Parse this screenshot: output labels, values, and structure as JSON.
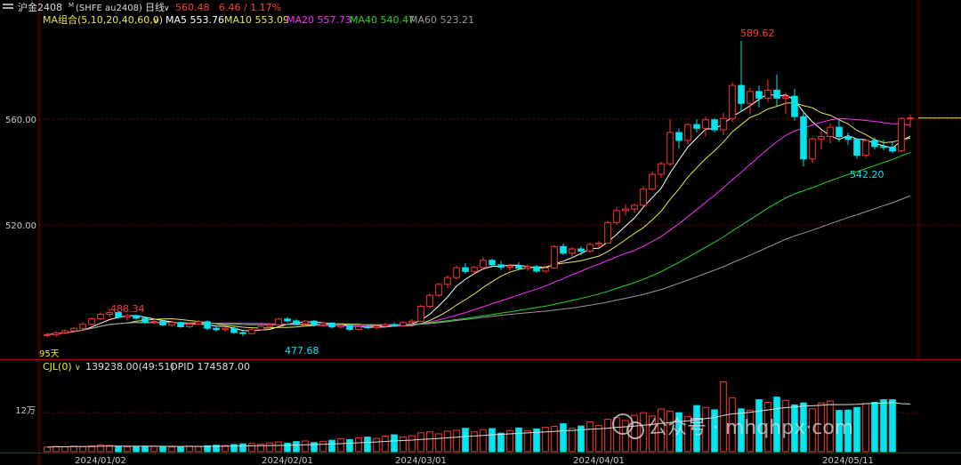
{
  "header": {
    "icon": "menu-lines-icon",
    "symbol": "沪金2408",
    "symbol_sup": "M",
    "code": "(SHFE au2408)",
    "period": "日线",
    "price": "560.48",
    "change": "6.46 / 1.17%"
  },
  "ma_legend": {
    "group": "MA组合(5,10,20,40,60,0)",
    "items": [
      {
        "label": "MA5 553.76",
        "color": "#ffffff"
      },
      {
        "label": "MA10 553.09",
        "color": "#e8e84a"
      },
      {
        "label": "MA20 557.73",
        "color": "#ff2cff"
      },
      {
        "label": "MA40 540.47",
        "color": "#22d822"
      },
      {
        "label": "MA60 523.21",
        "color": "#9a9a9a"
      }
    ]
  },
  "volume_legend": {
    "name": "CJL(0)",
    "vol": "139238.00(49:51)",
    "opid": "OPID 174587.00"
  },
  "price_axis": {
    "ticks": [
      {
        "value": 520,
        "label": "520.00"
      },
      {
        "value": 560,
        "label": "560.00"
      }
    ]
  },
  "volume_axis": {
    "tick_label": "12万",
    "tick_value": 120000
  },
  "annotations": {
    "high_label": "589.62",
    "low_label": "542.20",
    "left_high": "488.34",
    "left_low": "477.68",
    "corner": "95天"
  },
  "x_labels": [
    {
      "label": "2024/01/02",
      "index": 6
    },
    {
      "label": "2024/02/01",
      "index": 27
    },
    {
      "label": "2024/03/01",
      "index": 42
    },
    {
      "label": "2024/04/01",
      "index": 62
    },
    {
      "label": "2024/05/11",
      "index": 90
    }
  ],
  "watermark": "公众号 · mhqhpx·com",
  "colors": {
    "up": "#ff3232",
    "down": "#00e5ee",
    "grid": "#8b0000",
    "axis": "#8b0000"
  },
  "chart_data": {
    "type": "candlestick",
    "title": "沪金2408 日线",
    "ylim": [
      470,
      595
    ],
    "volume_ylim": [
      0,
      230000
    ],
    "candles": [
      [
        478.5,
        479.4,
        477.6,
        478.6
      ],
      [
        478.6,
        480.0,
        477.8,
        479.3
      ],
      [
        479.3,
        480.6,
        478.9,
        480.1
      ],
      [
        480.1,
        481.6,
        479.5,
        481.0
      ],
      [
        481.0,
        483.3,
        480.4,
        482.5
      ],
      [
        482.5,
        485.2,
        482.0,
        484.6
      ],
      [
        484.6,
        487.0,
        484.0,
        486.3
      ],
      [
        486.3,
        488.3,
        485.3,
        487.0
      ],
      [
        487.0,
        487.4,
        484.6,
        485.2
      ],
      [
        485.2,
        486.5,
        483.9,
        485.8
      ],
      [
        485.8,
        486.2,
        484.3,
        484.8
      ],
      [
        484.8,
        485.2,
        482.6,
        483.3
      ],
      [
        483.3,
        484.6,
        482.6,
        483.6
      ],
      [
        483.6,
        484.2,
        481.8,
        482.3
      ],
      [
        482.3,
        483.8,
        481.6,
        483.2
      ],
      [
        483.2,
        483.6,
        481.2,
        481.6
      ],
      [
        481.6,
        483.1,
        481.1,
        482.6
      ],
      [
        482.6,
        484.2,
        482.2,
        483.5
      ],
      [
        483.5,
        484.0,
        480.2,
        481.0
      ],
      [
        481.0,
        482.1,
        479.8,
        480.5
      ],
      [
        480.5,
        481.6,
        479.7,
        481.0
      ],
      [
        481.0,
        481.6,
        478.9,
        479.4
      ],
      [
        479.4,
        480.4,
        478.0,
        479.0
      ],
      [
        479.0,
        480.9,
        478.8,
        480.5
      ],
      [
        480.5,
        482.2,
        480.1,
        481.7
      ],
      [
        481.7,
        483.0,
        481.0,
        482.3
      ],
      [
        482.3,
        485.0,
        482.0,
        484.5
      ],
      [
        484.5,
        485.3,
        483.2,
        483.8
      ],
      [
        483.8,
        484.5,
        482.2,
        482.7
      ],
      [
        482.7,
        484.2,
        482.1,
        483.7
      ],
      [
        483.7,
        484.1,
        481.7,
        482.3
      ],
      [
        482.3,
        483.5,
        481.5,
        483.0
      ],
      [
        483.0,
        483.3,
        481.0,
        481.5
      ],
      [
        481.5,
        482.8,
        481.0,
        482.0
      ],
      [
        482.0,
        482.3,
        480.0,
        480.6
      ],
      [
        480.6,
        482.0,
        480.2,
        481.6
      ],
      [
        481.6,
        482.4,
        480.8,
        481.2
      ],
      [
        481.2,
        482.3,
        480.6,
        481.8
      ],
      [
        481.8,
        483.0,
        481.2,
        482.4
      ],
      [
        482.4,
        483.3,
        481.6,
        482.0
      ],
      [
        482.0,
        483.8,
        481.7,
        483.2
      ],
      [
        483.2,
        484.5,
        482.3,
        483.7
      ],
      [
        483.7,
        490.0,
        483.5,
        489.3
      ],
      [
        489.3,
        494.2,
        488.6,
        493.5
      ],
      [
        493.5,
        498.2,
        492.8,
        497.6
      ],
      [
        497.6,
        501.0,
        496.2,
        500.2
      ],
      [
        500.2,
        504.7,
        499.5,
        503.9
      ],
      [
        503.9,
        505.6,
        501.6,
        502.5
      ],
      [
        502.5,
        504.6,
        501.5,
        504.0
      ],
      [
        504.0,
        507.8,
        503.4,
        506.7
      ],
      [
        506.7,
        507.3,
        504.0,
        505.0
      ],
      [
        505.0,
        506.4,
        503.0,
        504.1
      ],
      [
        504.1,
        505.2,
        502.9,
        504.6
      ],
      [
        504.6,
        506.0,
        503.2,
        503.7
      ],
      [
        503.7,
        505.2,
        502.7,
        504.3
      ],
      [
        504.3,
        505.0,
        502.0,
        502.6
      ],
      [
        502.6,
        504.2,
        502.0,
        503.8
      ],
      [
        503.8,
        512.5,
        503.6,
        511.9
      ],
      [
        511.9,
        513.0,
        508.6,
        509.4
      ],
      [
        509.4,
        511.6,
        508.1,
        511.0
      ],
      [
        511.0,
        512.0,
        508.6,
        510.2
      ],
      [
        510.2,
        513.4,
        509.5,
        512.7
      ],
      [
        512.7,
        514.0,
        511.7,
        513.2
      ],
      [
        513.2,
        521.7,
        513.0,
        521.0
      ],
      [
        521.0,
        526.8,
        520.0,
        525.5
      ],
      [
        525.5,
        527.9,
        523.6,
        526.1
      ],
      [
        526.1,
        528.2,
        524.6,
        527.5
      ],
      [
        527.5,
        534.8,
        526.8,
        533.6
      ],
      [
        533.6,
        540.2,
        533.0,
        539.2
      ],
      [
        539.2,
        544.0,
        537.8,
        543.2
      ],
      [
        543.2,
        560.0,
        542.5,
        555.0
      ],
      [
        555.0,
        556.5,
        549.0,
        552.0
      ],
      [
        552.0,
        558.6,
        550.5,
        558.0
      ],
      [
        558.0,
        560.0,
        555.0,
        556.6
      ],
      [
        556.6,
        561.0,
        553.5,
        559.8
      ],
      [
        559.8,
        560.5,
        555.0,
        556.0
      ],
      [
        556.0,
        562.5,
        554.0,
        560.3
      ],
      [
        560.3,
        574.0,
        559.0,
        572.8
      ],
      [
        572.8,
        589.6,
        563.0,
        566.0
      ],
      [
        566.0,
        572.0,
        562.0,
        570.5
      ],
      [
        570.5,
        572.7,
        564.5,
        568.0
      ],
      [
        568.0,
        575.0,
        566.5,
        571.0
      ],
      [
        571.0,
        577.0,
        565.0,
        568.0
      ],
      [
        568.0,
        570.0,
        562.0,
        568.7
      ],
      [
        568.7,
        571.5,
        559.5,
        561.0
      ],
      [
        561.0,
        563.0,
        542.2,
        545.0
      ],
      [
        545.0,
        553.2,
        543.5,
        552.6
      ],
      [
        552.6,
        555.5,
        548.5,
        553.5
      ],
      [
        553.5,
        558.5,
        551.0,
        557.0
      ],
      [
        557.0,
        560.0,
        551.5,
        553.5
      ],
      [
        553.5,
        555.0,
        550.3,
        552.4
      ],
      [
        552.4,
        552.6,
        545.0,
        546.4
      ],
      [
        546.4,
        552.5,
        545.5,
        552.0
      ],
      [
        552.0,
        553.2,
        548.6,
        549.7
      ],
      [
        549.7,
        552.3,
        548.3,
        549.5
      ],
      [
        549.5,
        551.8,
        547.2,
        548.0
      ],
      [
        548.0,
        560.8,
        547.5,
        560.3
      ],
      [
        560.3,
        561.8,
        557.0,
        560.5
      ]
    ],
    "volumes": [
      14000,
      16000,
      15000,
      17000,
      15500,
      18000,
      21000,
      19000,
      16500,
      15000,
      15500,
      17000,
      16000,
      15000,
      14500,
      15000,
      17000,
      16000,
      18000,
      20000,
      19000,
      22000,
      24000,
      25000,
      23000,
      27000,
      30000,
      26000,
      31000,
      33000,
      28000,
      32000,
      35000,
      40000,
      37000,
      43000,
      45000,
      41000,
      48000,
      52000,
      45000,
      49000,
      58000,
      61000,
      55000,
      63000,
      66000,
      72000,
      61000,
      68000,
      71000,
      57000,
      65000,
      73000,
      64000,
      70000,
      75000,
      78000,
      86000,
      72000,
      79000,
      92000,
      81000,
      100000,
      105000,
      96000,
      112000,
      120000,
      110000,
      131000,
      125000,
      120000,
      108000,
      142000,
      136000,
      129000,
      215000,
      166000,
      132000,
      128000,
      160000,
      152000,
      168000,
      158000,
      144000,
      150000,
      132000,
      150000,
      156000,
      127000,
      128000,
      136000,
      148000,
      152000,
      160000,
      160000
    ],
    "up_flags": [
      1,
      1,
      1,
      1,
      1,
      1,
      1,
      1,
      0,
      1,
      0,
      0,
      1,
      0,
      1,
      0,
      1,
      1,
      0,
      0,
      1,
      0,
      0,
      1,
      1,
      1,
      1,
      0,
      0,
      1,
      0,
      1,
      0,
      1,
      0,
      1,
      0,
      1,
      1,
      0,
      1,
      1,
      1,
      1,
      1,
      1,
      1,
      0,
      1,
      1,
      0,
      0,
      1,
      0,
      1,
      0,
      1,
      1,
      0,
      1,
      0,
      1,
      1,
      1,
      1,
      1,
      1,
      1,
      1,
      1,
      1,
      0,
      1,
      0,
      1,
      0,
      1,
      1,
      0,
      1,
      0,
      1,
      0,
      1,
      0,
      0,
      1,
      1,
      1,
      0,
      0,
      0,
      1,
      0,
      0,
      0,
      1,
      1
    ]
  }
}
